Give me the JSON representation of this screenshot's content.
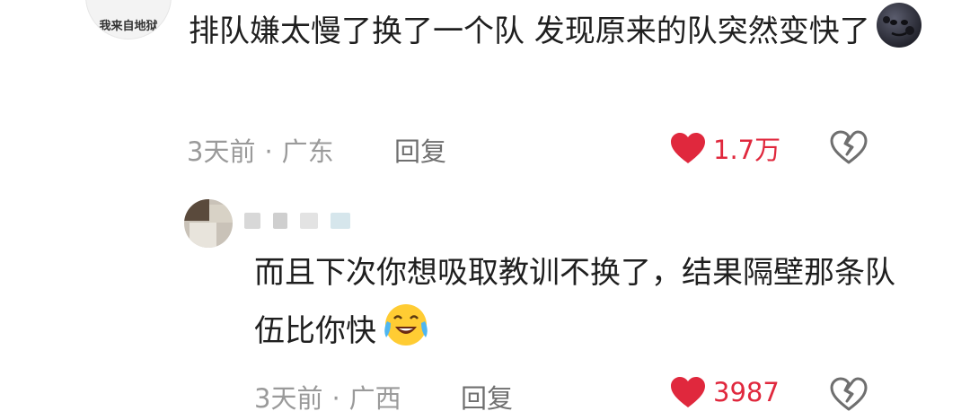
{
  "comment": {
    "avatar_caption": "我来自地狱",
    "text": "排队嫌太慢了换了一个队 发现原来的队突然变快了",
    "emoji": "new-moon-face-emoji",
    "time": "3天前",
    "location": "广东",
    "reply_label": "回复",
    "likes": "1.7万"
  },
  "reply": {
    "text": "而且下次你想吸取教训不换了，结果隔壁那条队伍比你快",
    "emoji": "crying-laughing-face-emoji",
    "time": "3天前",
    "location": "广西",
    "reply_label": "回复",
    "likes": "3987"
  },
  "separator": "·",
  "colors": {
    "like": "#e0283d",
    "meta": "#9a9a9a",
    "text": "#1f1f1f"
  }
}
